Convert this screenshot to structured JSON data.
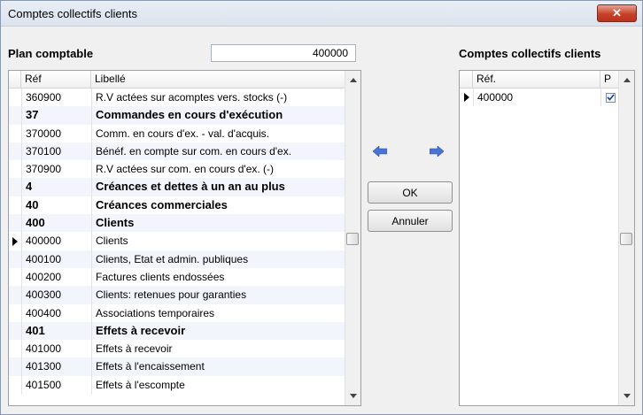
{
  "window": {
    "title": "Comptes collectifs clients",
    "close_glyph": "✕"
  },
  "left": {
    "label": "Plan comptable",
    "search_value": "400000",
    "columns": [
      "Réf",
      "Libellé"
    ],
    "rows": [
      {
        "ref": "360900",
        "lib": "R.V actées sur acomptes vers. stocks (-)",
        "bold": false
      },
      {
        "ref": "37",
        "lib": "Commandes en cours d'exécution",
        "bold": true
      },
      {
        "ref": "370000",
        "lib": "Comm. en cours d'ex. - val. d'acquis.",
        "bold": false
      },
      {
        "ref": "370100",
        "lib": "Bénéf. en compte sur com. en cours d'ex.",
        "bold": false
      },
      {
        "ref": "370900",
        "lib": "R.V actées sur com. en cours d'ex. (-)",
        "bold": false
      },
      {
        "ref": "4",
        "lib": "Créances et dettes à un an au plus",
        "bold": true
      },
      {
        "ref": "40",
        "lib": "Créances commerciales",
        "bold": true
      },
      {
        "ref": "400",
        "lib": "Clients",
        "bold": true
      },
      {
        "ref": "400000",
        "lib": "Clients",
        "bold": false,
        "current": true
      },
      {
        "ref": "400100",
        "lib": "Clients, Etat et admin. publiques",
        "bold": false
      },
      {
        "ref": "400200",
        "lib": "Factures clients endossées",
        "bold": false
      },
      {
        "ref": "400300",
        "lib": "Clients: retenues pour garanties",
        "bold": false
      },
      {
        "ref": "400400",
        "lib": "Associations temporaires",
        "bold": false
      },
      {
        "ref": "401",
        "lib": "Effets à recevoir",
        "bold": true
      },
      {
        "ref": "401000",
        "lib": "Effets à recevoir",
        "bold": false
      },
      {
        "ref": "401300",
        "lib": "Effets à l'encaissement",
        "bold": false
      },
      {
        "ref": "401500",
        "lib": "Effets à l'escompte",
        "bold": false
      }
    ]
  },
  "middle": {
    "ok_label": "OK",
    "cancel_label": "Annuler"
  },
  "right": {
    "label": "Comptes collectifs clients",
    "columns": [
      "Réf.",
      "P"
    ],
    "rows": [
      {
        "ref": "400000",
        "p": true
      }
    ]
  },
  "colors": {
    "arrow_blue": "#4a73d6",
    "selection": "#3399ff"
  }
}
